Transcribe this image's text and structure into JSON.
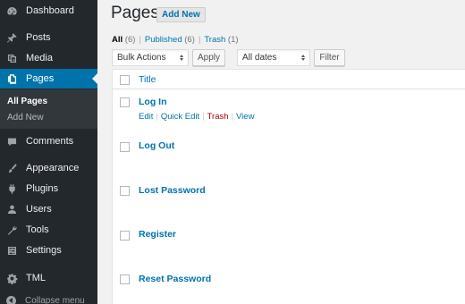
{
  "sidebar": {
    "dashboard": "Dashboard",
    "posts": "Posts",
    "media": "Media",
    "pages": "Pages",
    "sub_all_pages": "All Pages",
    "sub_add_new": "Add New",
    "comments": "Comments",
    "appearance": "Appearance",
    "plugins": "Plugins",
    "users": "Users",
    "tools": "Tools",
    "settings": "Settings",
    "tml": "TML",
    "collapse": "Collapse menu"
  },
  "header": {
    "title": "Pages",
    "add_new": "Add New"
  },
  "views": {
    "all": "All",
    "all_count": "(6)",
    "published": "Published",
    "published_count": "(6)",
    "trash": "Trash",
    "trash_count": "(1)",
    "sep": "|"
  },
  "toolbar": {
    "bulk_actions": "Bulk Actions",
    "apply": "Apply",
    "dates": "All dates",
    "filter": "Filter"
  },
  "table": {
    "column_title": "Title",
    "rows": [
      "Log In",
      "Log Out",
      "Lost Password",
      "Register",
      "Reset Password"
    ],
    "row_actions": {
      "edit": "Edit",
      "quick_edit": "Quick Edit",
      "trash": "Trash",
      "view": "View"
    }
  },
  "colors": {
    "sidebar_bg": "#23282d",
    "accent": "#0073aa",
    "trash_red": "#a00000"
  }
}
